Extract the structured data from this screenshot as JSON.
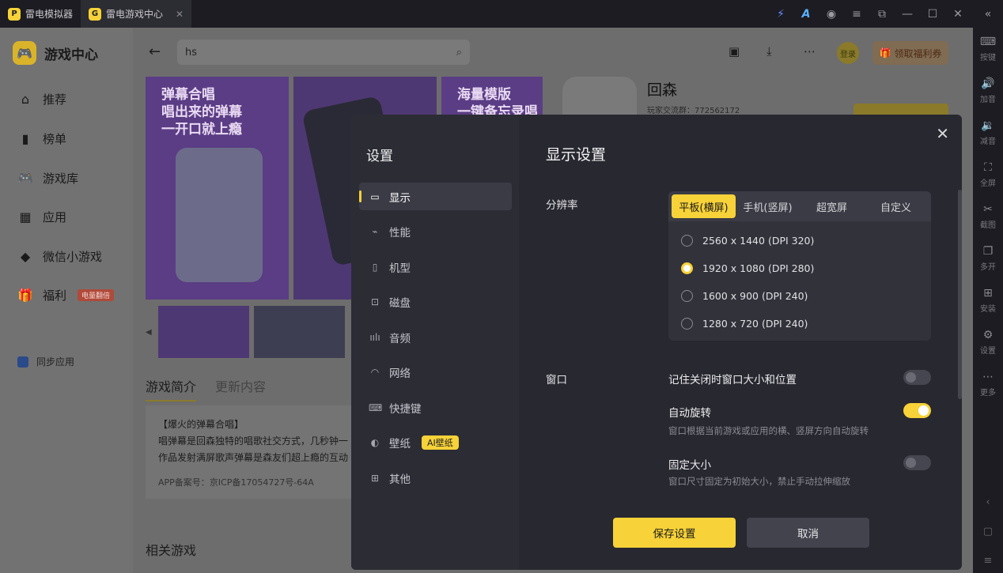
{
  "titlebar": {
    "tabs": [
      {
        "label": "雷电模拟器",
        "logo": "P"
      },
      {
        "label": "雷电游戏中心",
        "logo": "G",
        "close": "✕"
      }
    ]
  },
  "right_sidebar": {
    "items": [
      {
        "label": "按键",
        "icon": "keyboard-icon"
      },
      {
        "label": "加音",
        "icon": "volume-up-icon"
      },
      {
        "label": "减音",
        "icon": "volume-down-icon"
      },
      {
        "label": "全屏",
        "icon": "fullscreen-icon"
      },
      {
        "label": "截图",
        "icon": "scissors-icon"
      },
      {
        "label": "多开",
        "icon": "multi-window-icon"
      },
      {
        "label": "安装",
        "icon": "install-icon"
      },
      {
        "label": "设置",
        "icon": "gear-icon"
      },
      {
        "label": "更多",
        "icon": "more-icon"
      }
    ]
  },
  "left_nav": {
    "app_title": "游戏中心",
    "items": [
      {
        "label": "推荐",
        "icon": "home-icon"
      },
      {
        "label": "榜单",
        "icon": "ranking-icon"
      },
      {
        "label": "游戏库",
        "icon": "gamepad-icon"
      },
      {
        "label": "应用",
        "icon": "apps-icon"
      },
      {
        "label": "微信小游戏",
        "icon": "mini-game-icon"
      },
      {
        "label": "福利",
        "icon": "gift-icon",
        "badge": "电量翻倍"
      }
    ],
    "sync_label": "同步应用"
  },
  "main": {
    "search_value": "hs",
    "login_label": "登录",
    "gift_label": "领取福利券",
    "banners": [
      {
        "text_line1": "弹幕合唱",
        "text_line2": "唱出来的弹幕",
        "text_line3": "一开口就上瘾"
      },
      {
        "text_line1": "",
        "text_line2": "",
        "text_line3": ""
      },
      {
        "text_line1": "海量模版",
        "text_line2": "一键备忘录唱",
        "text_line3": ""
      }
    ],
    "app_name": "回森",
    "app_sub": "玩家交流群：772562172",
    "tabs": [
      "游戏简介",
      "更新内容"
    ],
    "intro_lines": [
      "【爆火的弹幕合唱】",
      "唱弹幕是回森独特的唱歌社交方式，几秒钟一",
      "作品发射满屏歌声弹幕是森友们超上瘾的互动"
    ],
    "icp": "APP备案号：京ICP备17054727号-64A",
    "related_title": "相关游戏"
  },
  "modal": {
    "left_title": "设置",
    "menu": [
      {
        "label": "显示",
        "icon": "monitor-icon",
        "active": true
      },
      {
        "label": "性能",
        "icon": "performance-icon"
      },
      {
        "label": "机型",
        "icon": "phone-icon"
      },
      {
        "label": "磁盘",
        "icon": "disk-icon"
      },
      {
        "label": "音频",
        "icon": "audio-icon"
      },
      {
        "label": "网络",
        "icon": "wifi-icon"
      },
      {
        "label": "快捷键",
        "icon": "keyboard-icon"
      },
      {
        "label": "壁纸",
        "icon": "palette-icon",
        "badge": "AI壁纸"
      },
      {
        "label": "其他",
        "icon": "grid-icon"
      }
    ],
    "title": "显示设置",
    "resolution_label": "分辨率",
    "segments": [
      "平板(横屏)",
      "手机(竖屏)",
      "超宽屏",
      "自定义"
    ],
    "active_segment": "平板(横屏)",
    "resolutions": [
      {
        "label": "2560 x 1440  (DPI 320)",
        "selected": false
      },
      {
        "label": "1920 x 1080  (DPI 280)",
        "selected": true
      },
      {
        "label": "1600 x 900  (DPI 240)",
        "selected": false
      },
      {
        "label": "1280 x 720  (DPI 240)",
        "selected": false
      }
    ],
    "window_label": "窗口",
    "options": [
      {
        "title": "记住关闭时窗口大小和位置",
        "desc": "",
        "on": false
      },
      {
        "title": "自动旋转",
        "desc": "窗口根据当前游戏或应用的横、竖屏方向自动旋转",
        "on": true
      },
      {
        "title": "固定大小",
        "desc": "窗口尺寸固定为初始大小，禁止手动拉伸缩放",
        "on": false
      }
    ],
    "save_label": "保存设置",
    "cancel_label": "取消"
  },
  "colors": {
    "accent": "#f7d238",
    "modal_bg": "#282830",
    "modal_sidebar": "#2c2c35"
  }
}
